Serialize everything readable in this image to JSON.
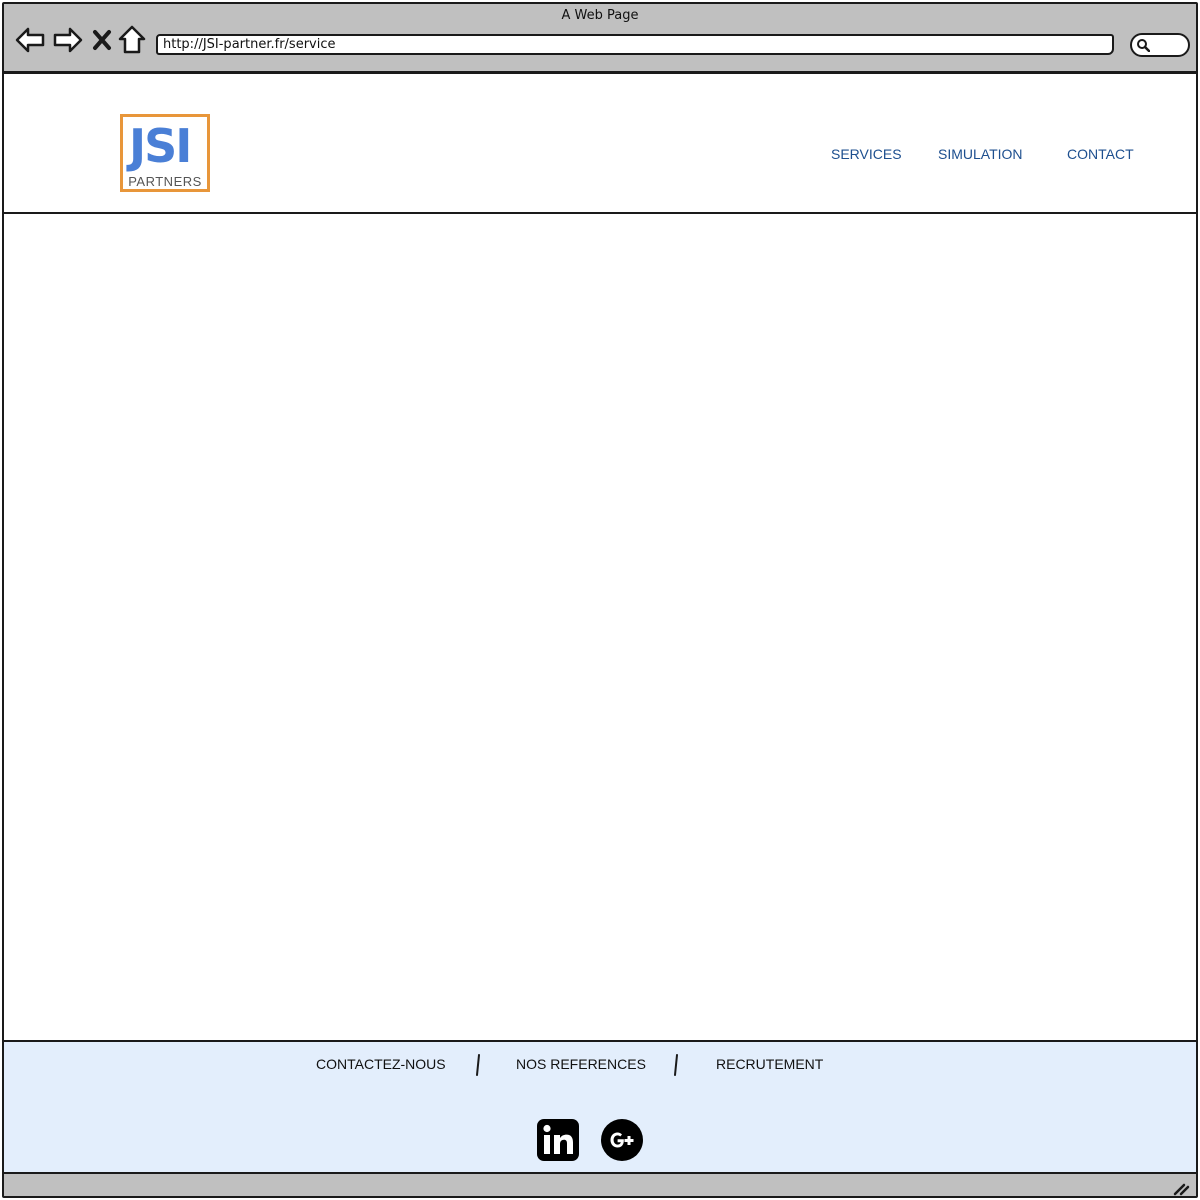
{
  "browser": {
    "window_title": "A Web Page",
    "url": "http://JSI-partner.fr/service"
  },
  "header": {
    "logo": {
      "mark": "JSI",
      "subtitle": "PARTNERS",
      "border_color": "#e8963a",
      "mark_color": "#4a7fd6"
    },
    "nav": {
      "services": "SERVICES",
      "simulation": "SIMULATION",
      "contact": "CONTACT"
    },
    "nav_color": "#1d4f8f"
  },
  "footer": {
    "background": "#e3eefc",
    "links": {
      "contact": "CONTACTEZ-NOUS",
      "references": "NOS REFERENCES",
      "recruitment": "RECRUTEMENT"
    },
    "social": [
      "linkedin-icon",
      "google-plus-icon"
    ]
  },
  "icons": {
    "back": "arrow-left-icon",
    "forward": "arrow-right-icon",
    "stop": "close-icon",
    "home": "home-icon",
    "search": "search-icon",
    "resize": "resize-grip-icon"
  }
}
